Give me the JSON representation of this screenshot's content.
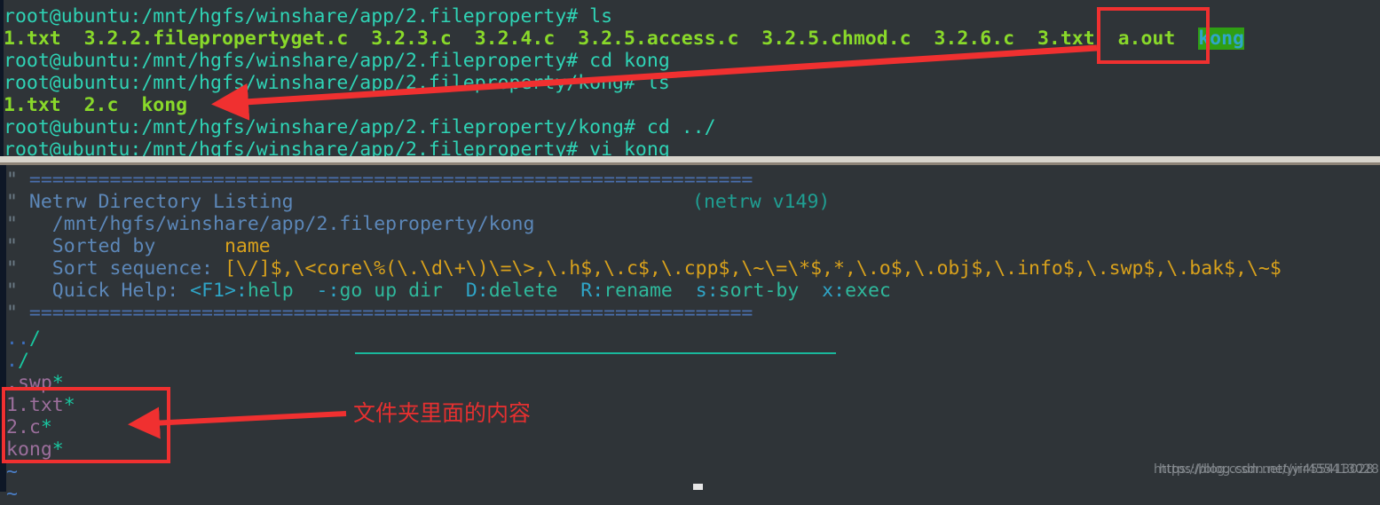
{
  "terminal": {
    "background": "#2f3438",
    "prompt_color": "#2fd3b5",
    "file_color": "#89d92a",
    "dir_highlight_bg": "#2f9e14",
    "dir_highlight_fg": "#2fa5c7",
    "lines": [
      {
        "type": "prompt",
        "prompt": "root@ubuntu:/mnt/hgfs/winshare/app/2.fileproperty# ",
        "command": "ls"
      },
      {
        "type": "output",
        "text": "1.txt  3.2.2.filepropertyget.c  3.2.3.c  3.2.4.c  3.2.5.access.c  3.2.5.chmod.c  3.2.6.c  3.txt  a.out  ",
        "highlight": "kong"
      },
      {
        "type": "prompt",
        "prompt": "root@ubuntu:/mnt/hgfs/winshare/app/2.fileproperty# ",
        "command": "cd kong"
      },
      {
        "type": "prompt",
        "prompt": "root@ubuntu:/mnt/hgfs/winshare/app/2.fileproperty/kong# ",
        "command": "ls"
      },
      {
        "type": "output",
        "text": "1.txt  2.c  kong",
        "highlight": ""
      },
      {
        "type": "prompt",
        "prompt": "root@ubuntu:/mnt/hgfs/winshare/app/2.fileproperty/kong# ",
        "command": "cd ../"
      },
      {
        "type": "prompt",
        "prompt": "root@ubuntu:/mnt/hgfs/winshare/app/2.fileproperty# ",
        "command": "vi kong"
      }
    ]
  },
  "netrw": {
    "divider": "===============================================================",
    "title": "Netrw Directory Listing",
    "version": "(netrw v149)",
    "path": "/mnt/hgfs/winshare/app/2.fileproperty/kong",
    "sorted_by_label": "Sorted by",
    "sorted_by_value": "name",
    "sort_sequence_label": "Sort sequence: ",
    "sort_sequence_value": "[\\/]$,\\<core\\%(\\.\\d\\+\\)\\=\\>,\\.h$,\\.c$,\\.cpp$,\\~\\=\\*$,*,\\.o$,\\.obj$,\\.info$,\\.swp$,\\.bak$,\\~$",
    "quick_help_label": "Quick Help: ",
    "quick_help_items": [
      {
        "key": "<F1>",
        "sep": ":",
        "desc": "help"
      },
      {
        "key": "-",
        "sep": ":",
        "desc": "go up dir"
      },
      {
        "key": "D",
        "sep": ":",
        "desc": "delete"
      },
      {
        "key": "R",
        "sep": ":",
        "desc": "rename"
      },
      {
        "key": "s",
        "sep": ":",
        "desc": "sort-by"
      },
      {
        "key": "x",
        "sep": ":",
        "desc": "exec"
      }
    ],
    "entries": [
      {
        "dots": "..",
        "name": "",
        "suffix": "/"
      },
      {
        "dots": ".",
        "name": "",
        "suffix": "/"
      },
      {
        "dots": "",
        "name": ".swp",
        "suffix": "*"
      },
      {
        "dots": "",
        "name": "1.txt",
        "suffix": "*"
      },
      {
        "dots": "",
        "name": "2.c",
        "suffix": "*"
      },
      {
        "dots": "",
        "name": "kong",
        "suffix": "*"
      }
    ],
    "empty_markers": [
      "~",
      "~"
    ]
  },
  "annotations": {
    "color": "#e53030",
    "chinese_note": "文件夹里面的内容",
    "box_kong_label": "kong-highlight-box",
    "box_files_label": "folder-contents-box"
  },
  "watermark": {
    "line_a": "https://blog.csdn.net/yir455413028",
    "line_b": "https://blog.csdn.net/yir455413028"
  }
}
